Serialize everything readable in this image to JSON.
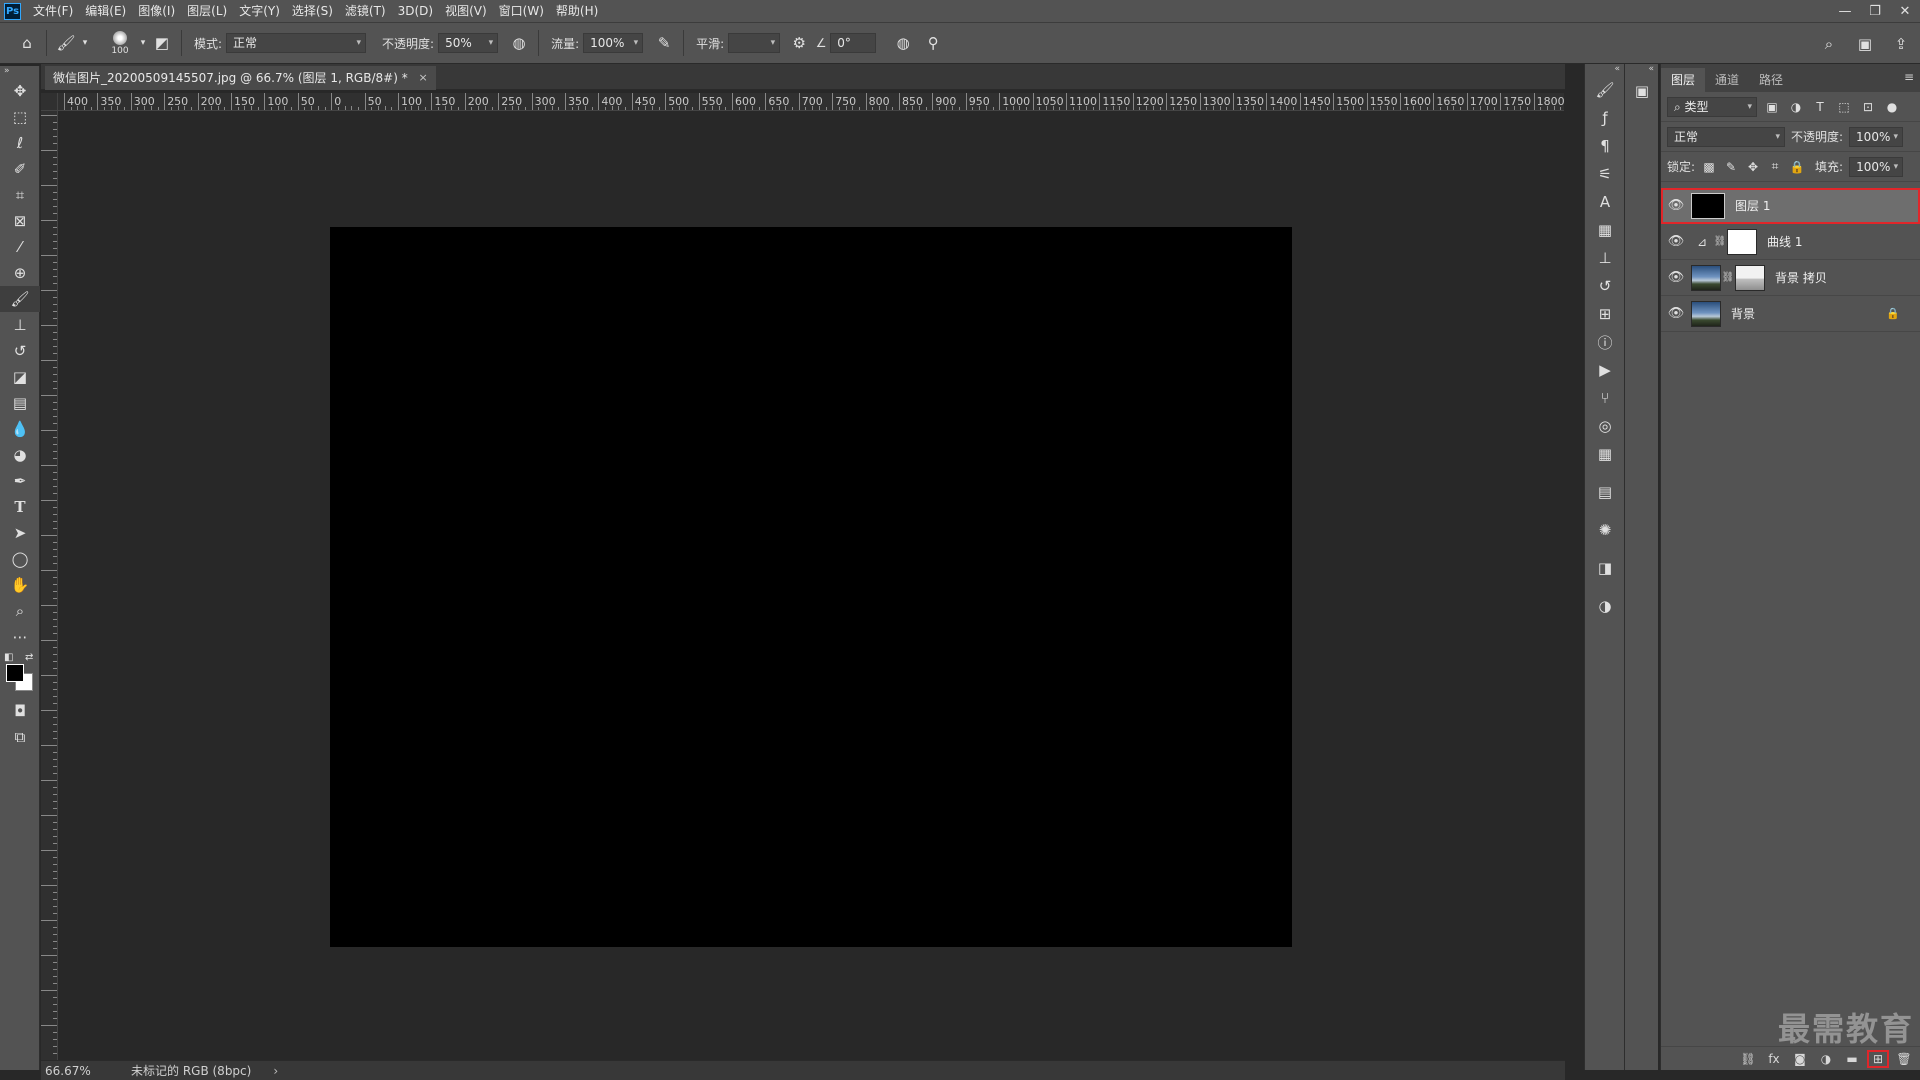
{
  "menu": {
    "logo": "Ps",
    "items": [
      "文件(F)",
      "编辑(E)",
      "图像(I)",
      "图层(L)",
      "文字(Y)",
      "选择(S)",
      "滤镜(T)",
      "3D(D)",
      "视图(V)",
      "窗口(W)",
      "帮助(H)"
    ]
  },
  "window_controls": {
    "minimize": "—",
    "restore": "❐",
    "close": "✕"
  },
  "options": {
    "brush_size": "100",
    "mode_label": "模式:",
    "mode_value": "正常",
    "opacity_label": "不透明度:",
    "opacity_value": "50%",
    "flow_label": "流量:",
    "flow_value": "100%",
    "smooth_label": "平滑:",
    "smooth_value": "",
    "angle_value": "0°"
  },
  "document": {
    "tab_title": "微信图片_20200509145507.jpg @ 66.7% (图层 1, RGB/8#) *",
    "close": "×"
  },
  "ruler": {
    "top_labels": [
      "400",
      "350",
      "300",
      "250",
      "200",
      "150",
      "100",
      "50",
      "0",
      "50",
      "100",
      "150",
      "200",
      "250",
      "300",
      "350",
      "400",
      "450",
      "500",
      "550",
      "600",
      "650",
      "700",
      "750",
      "800",
      "850",
      "900",
      "950",
      "1000",
      "1050",
      "1100",
      "1150",
      "1200",
      "1250",
      "1300",
      "1350",
      "1400",
      "1450",
      "1500",
      "1550",
      "1600",
      "1650",
      "1700",
      "1750",
      "1800"
    ]
  },
  "status": {
    "zoom": "66.67%",
    "info": "未标记的 RGB (8bpc)",
    "arrow": "›"
  },
  "layers_panel": {
    "tabs": [
      "图层",
      "通道",
      "路径"
    ],
    "menu_icon": "≡",
    "filter_kind": "类型",
    "blend_mode": "正常",
    "opacity_label": "不透明度:",
    "opacity_value": "100%",
    "lock_label": "锁定:",
    "fill_label": "填充:",
    "fill_value": "100%",
    "layers": [
      {
        "name": "图层 1",
        "selected": true
      },
      {
        "name": "曲线 1",
        "selected": false
      },
      {
        "name": "背景 拷贝",
        "selected": false
      },
      {
        "name": "背景",
        "selected": false,
        "locked": true
      }
    ]
  },
  "watermark": "最需教育",
  "colors": {
    "accent_red": "#e0262a",
    "ps_blue": "#31a8ff",
    "panel_bg": "#535353",
    "canvas_bg": "#282828"
  }
}
